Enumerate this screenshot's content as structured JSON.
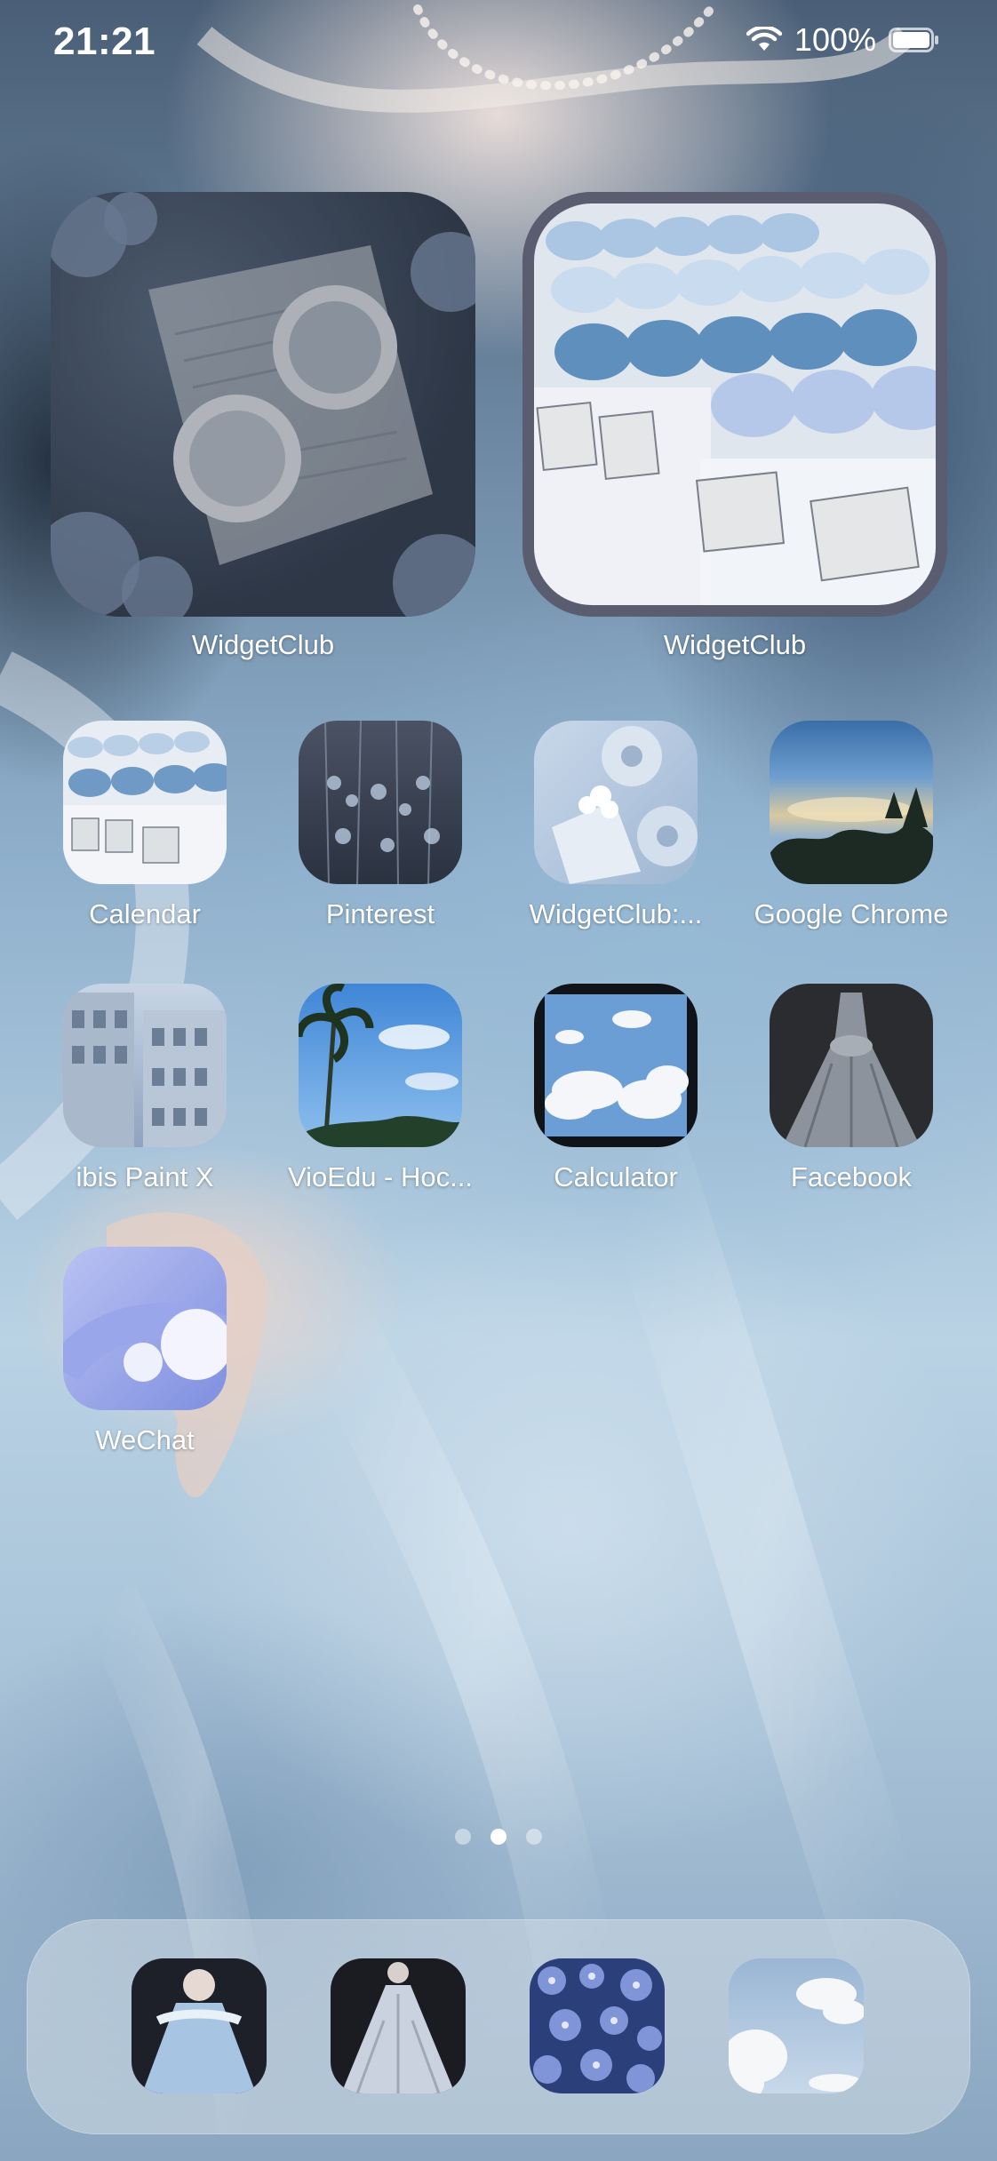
{
  "status_bar": {
    "time": "21:21",
    "battery_percent": "100%",
    "battery_level": 1.0,
    "icons": [
      "wifi-icon",
      "battery-icon"
    ]
  },
  "widgets": [
    {
      "label": "WidgetClub",
      "image": "tea-cups-hydrangea-widget"
    },
    {
      "label": "WidgetClub",
      "image": "blue-macarons-widget"
    }
  ],
  "apps": [
    {
      "label": "Calendar",
      "icon": "calendar-macarons-icon"
    },
    {
      "label": "Pinterest",
      "icon": "pinterest-flowers-icon"
    },
    {
      "label": "WidgetClub:...",
      "icon": "widgetclub-flowers-icon"
    },
    {
      "label": "Google Chrome",
      "icon": "chrome-sky-icon"
    },
    {
      "label": "ibis Paint X",
      "icon": "ibis-paint-buildings-icon"
    },
    {
      "label": "VioEdu - Hoc...",
      "icon": "vioedu-palm-sky-icon"
    },
    {
      "label": "Calculator",
      "icon": "calculator-clouds-icon"
    },
    {
      "label": "Facebook",
      "icon": "facebook-gown-icon"
    },
    {
      "label": "WeChat",
      "icon": "wechat-abstract-icon"
    }
  ],
  "page_indicator": {
    "pages": 3,
    "current": 2
  },
  "dock": [
    {
      "icon": "dock-doll-dress-icon"
    },
    {
      "icon": "dock-white-gown-icon"
    },
    {
      "icon": "dock-blue-flowers-icon"
    },
    {
      "icon": "dock-clouds-icon"
    }
  ],
  "colors": {
    "wallpaper_primary": "#8fb0cc",
    "label_text": "#ffffff",
    "widget_frame": "#5a5d70"
  }
}
